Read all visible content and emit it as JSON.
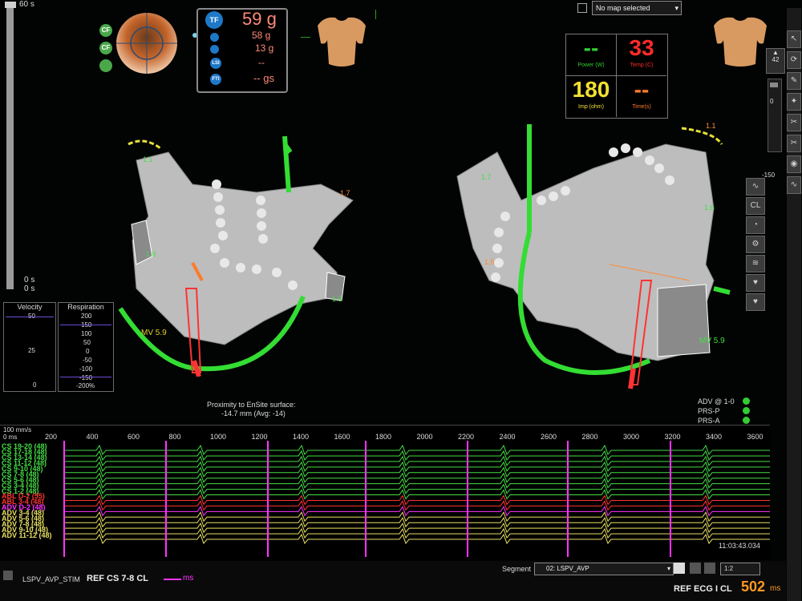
{
  "top_left": {
    "slider_top": "60 s",
    "slider_mid": "0 s",
    "slider_bot": "0 s"
  },
  "force": {
    "total": "59 g",
    "axial": "58 g",
    "lateral": "13 g",
    "dashes": "--",
    "gs": "-- gs",
    "buttons": [
      "TF",
      "LSI",
      "FTI"
    ],
    "left_buttons": [
      "CF",
      "CF",
      ""
    ]
  },
  "map_select": {
    "value": "No map selected"
  },
  "rf": {
    "power_value": "--",
    "power_unit": "Power (W)",
    "temp_value": "33",
    "temp_unit": "Temp (C)",
    "imp_value": "180",
    "imp_unit": "Imp (ohm)",
    "time_value": "--",
    "time_unit": "Time(s)"
  },
  "velocity": {
    "title": "Velocity",
    "top": "50",
    "mid": "25",
    "bot": "0"
  },
  "respiration": {
    "title": "Respiration",
    "ticks": [
      "200",
      "150",
      "100",
      "50",
      "0",
      "-50",
      "-100",
      "-150",
      "-200%"
    ]
  },
  "map_labels": {
    "left": {
      "tag1": "1.6",
      "tag2": "1.7",
      "tag3": "1.5",
      "tag4": "1.1",
      "mv": "MV 5.9"
    },
    "right": {
      "tag1": "1.7",
      "tag2": "1.1",
      "tag3": "1.6",
      "tag4": "1.5",
      "mv": "MV 5.9"
    }
  },
  "proximity": {
    "title": "Proximity to EnSite surface:",
    "value": "-14.7 mm (Avg: -14)"
  },
  "status_dots": [
    {
      "label": "ADV @ 1-0"
    },
    {
      "label": "PRS-P"
    },
    {
      "label": "PRS-A"
    }
  ],
  "right_panel": {
    "zoom": "42",
    "val0": "0",
    "val150": "-150"
  },
  "ecg": {
    "scale_label": "100 mm/s",
    "ms_label": "0 ms",
    "ruler": [
      "200",
      "400",
      "600",
      "800",
      "1000",
      "1200",
      "1400",
      "1600",
      "1800",
      "2000",
      "2200",
      "2400",
      "2600",
      "2800",
      "3000",
      "3200",
      "3400",
      "3600"
    ],
    "channels": [
      {
        "name": "CS 19-20 (48)",
        "color": "#44dd44"
      },
      {
        "name": "CS 17-18 (48)",
        "color": "#44dd44"
      },
      {
        "name": "CS 13-14 (48)",
        "color": "#44dd44"
      },
      {
        "name": "CS 11-12 (48)",
        "color": "#44dd44"
      },
      {
        "name": "CS 9-10 (48)",
        "color": "#44dd44"
      },
      {
        "name": "CS 7-8 (48)",
        "color": "#44dd44"
      },
      {
        "name": "CS 5-6 (48)",
        "color": "#44dd44"
      },
      {
        "name": "CS 3-4 (48)",
        "color": "#44dd44"
      },
      {
        "name": "CS 1-2 (48)",
        "color": "#44dd44"
      },
      {
        "name": "ABL D-2 (55)",
        "color": "#ff3333"
      },
      {
        "name": "ABL 3-4 (48)",
        "color": "#ff3333"
      },
      {
        "name": "ADV D-2 (48)",
        "color": "#ff33ff"
      },
      {
        "name": "ADV 3-4 (48)",
        "color": "#e8e060"
      },
      {
        "name": "ADV 5-6 (48)",
        "color": "#e8e060"
      },
      {
        "name": "ADV 7-8 (48)",
        "color": "#e8e060"
      },
      {
        "name": "ADV 9-10 (48)",
        "color": "#e8e060"
      },
      {
        "name": "ADV 11-12 (48)",
        "color": "#e8e060"
      }
    ],
    "timestamp": "11:03:43.034"
  },
  "bottom_bar": {
    "stim_label": "LSPV_AVP_STIM",
    "ref_label": "REF CS  7-8 CL",
    "ms_unit": "ms",
    "segment_label": "Segment",
    "segment_value": "02: LSPV_AVP",
    "speed_value": "1:2",
    "ref_ecg": "REF ECG I CL",
    "ref_ecg_value": "502",
    "ref_ecg_unit": "ms"
  }
}
